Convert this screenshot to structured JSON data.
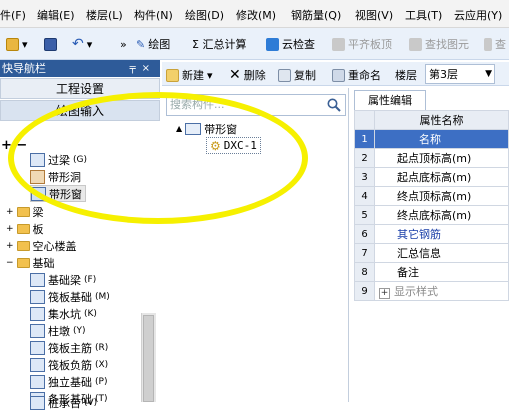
{
  "menu": [
    "件(F)",
    "编辑(E)",
    "楼层(L)",
    "构件(N)",
    "绘图(D)",
    "修改(M)",
    "钢筋量(Q)",
    "视图(V)",
    "工具(T)",
    "云应用(Y)"
  ],
  "toolbar": {
    "draw": "绘图",
    "sum": "Σ 汇总计算",
    "cloud_check": "云检查",
    "flush_slab": "平齐板顶",
    "find_element": "查找图元",
    "more": "查"
  },
  "nav": {
    "title": "快导航栏",
    "tab_project": "工程设置",
    "tab_draw": "绘图输入",
    "items": [
      {
        "label": "过梁",
        "suffix": "(G)"
      },
      {
        "label": "带形洞",
        "suffix": ""
      },
      {
        "label": "带形窗",
        "suffix": ""
      },
      {
        "label": "梁",
        "suffix": ""
      },
      {
        "label": "板",
        "suffix": ""
      },
      {
        "label": "空心楼盖",
        "suffix": ""
      },
      {
        "label": "基础",
        "suffix": ""
      },
      {
        "label": "基础梁",
        "suffix": "(F)"
      },
      {
        "label": "筏板基础",
        "suffix": "(M)"
      },
      {
        "label": "集水坑",
        "suffix": "(K)"
      },
      {
        "label": "柱墩",
        "suffix": "(Y)"
      },
      {
        "label": "筏板主筋",
        "suffix": "(R)"
      },
      {
        "label": "筏板负筋",
        "suffix": "(X)"
      },
      {
        "label": "独立基础",
        "suffix": "(P)"
      },
      {
        "label": "条形基础",
        "suffix": "(T)"
      },
      {
        "label": "桩承台",
        "suffix": "(V)"
      }
    ]
  },
  "comp_toolbar": {
    "new": "新建",
    "delete": "删除",
    "copy": "复制",
    "rename": "重命名",
    "floor_label": "楼层",
    "floor_value": "第3层"
  },
  "search": {
    "placeholder": "搜索构件..."
  },
  "tree": {
    "root": "带形窗",
    "child": "DXC-1"
  },
  "props": {
    "tab": "属性编辑",
    "header": "属性名称",
    "rows": [
      {
        "num": "1",
        "name": "名称"
      },
      {
        "num": "2",
        "name": "起点顶标高(m)"
      },
      {
        "num": "3",
        "name": "起点底标高(m)"
      },
      {
        "num": "4",
        "name": "终点顶标高(m)"
      },
      {
        "num": "5",
        "name": "终点底标高(m)"
      },
      {
        "num": "6",
        "name": "其它钢筋"
      },
      {
        "num": "7",
        "name": "汇总信息"
      },
      {
        "num": "8",
        "name": "备注"
      },
      {
        "num": "9",
        "name": "显示样式"
      }
    ]
  },
  "colors": {
    "highlight": "#f6f000",
    "selected_row": "#3d6fc4",
    "nav_header": "#2e5b99"
  }
}
